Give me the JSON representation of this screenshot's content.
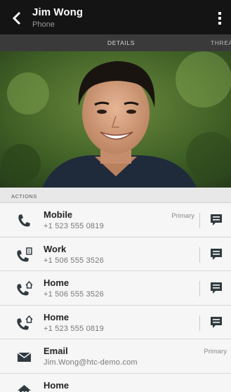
{
  "header": {
    "name": "Jim Wong",
    "subtitle": "Phone"
  },
  "tabs": [
    {
      "label": "DETAILS"
    },
    {
      "label": "THREA"
    }
  ],
  "section": {
    "label": "ACTIONS"
  },
  "rows": [
    {
      "label": "Mobile",
      "value": "+1 523 555 0819",
      "primary": "Primary",
      "icon": "phone-mobile-icon"
    },
    {
      "label": "Work",
      "value": "+1 506 555 3526",
      "icon": "phone-work-icon"
    },
    {
      "label": "Home",
      "value": "+1 506 555 3526",
      "icon": "phone-home-icon"
    },
    {
      "label": "Home",
      "value": "+1 523 555 0819",
      "icon": "phone-home-icon"
    },
    {
      "label": "Email",
      "value": "Jim.Wong@htc-demo.com",
      "primary": "Primary",
      "icon": "email-icon"
    },
    {
      "label": "Home",
      "value": "",
      "icon": "home-address-icon"
    }
  ],
  "colors": {
    "titlebar": "#141414",
    "tabbar": "#3a3a3a",
    "list_bg": "#f6f6f6",
    "icon": "#2f3a40"
  }
}
